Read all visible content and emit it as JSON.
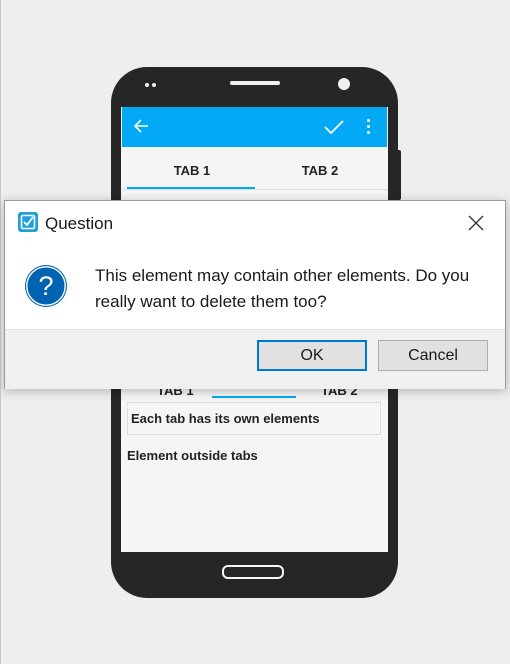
{
  "phone_app": {
    "tabs": [
      "TAB 1",
      "TAB 2"
    ],
    "peek_tabs": [
      "TAB 1",
      "TAB 2"
    ],
    "tab_content_text": "Each tab has its own elements",
    "outside_text": "Element outside tabs",
    "accent_color": "#03a9f4",
    "icons": {
      "back": "arrow-left-icon",
      "confirm": "check-icon",
      "menu": "more-vertical-icon"
    }
  },
  "dialog": {
    "title": "Question",
    "message": "This element may contain other elements. Do you really want to delete them too?",
    "buttons": {
      "ok": "OK",
      "cancel": "Cancel"
    },
    "icons": {
      "app": "checkbox-app-icon",
      "question": "question-mark-icon",
      "close": "close-icon"
    },
    "question_icon_color": "#0063b1",
    "default_button_border": "#0078d7"
  }
}
